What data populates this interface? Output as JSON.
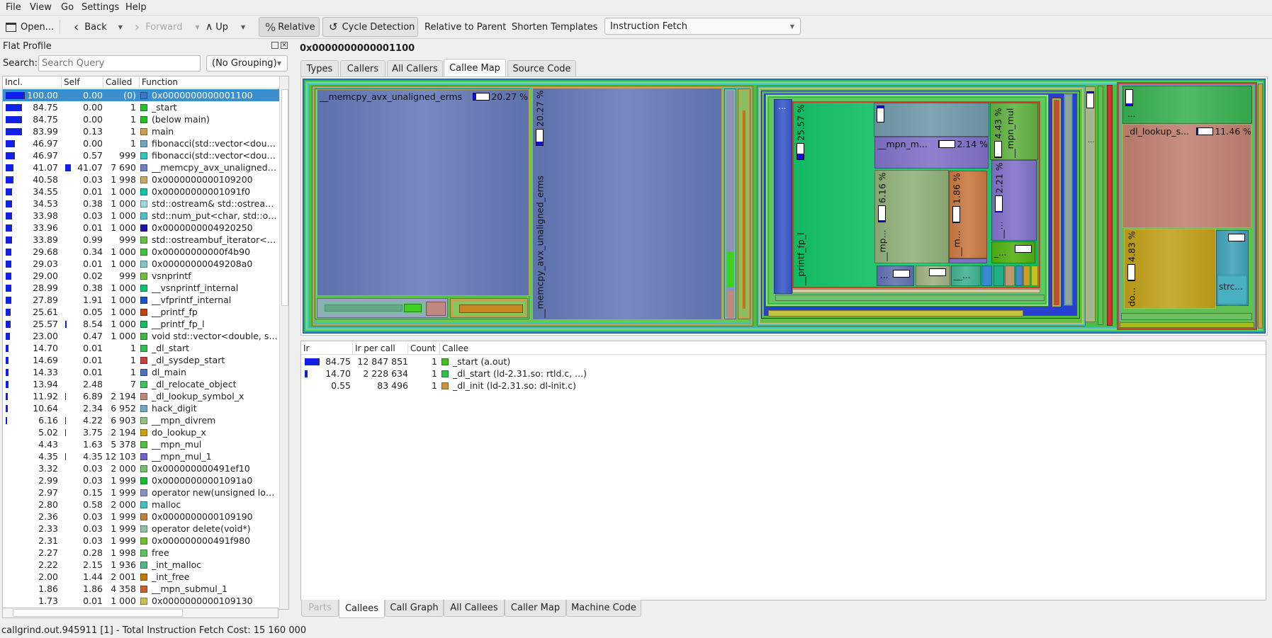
{
  "menu": [
    "File",
    "View",
    "Go",
    "Settings",
    "Help"
  ],
  "toolbar": {
    "open": "Open...",
    "back": "Back",
    "forward": "Forward",
    "up": "Up",
    "relative": "Relative",
    "cycle": "Cycle Detection",
    "relative_parent": "Relative to Parent",
    "shorten": "Shorten Templates",
    "event_type": "Instruction Fetch"
  },
  "flat_profile": {
    "title": "Flat Profile",
    "search_label": "Search:",
    "search_placeholder": "Search Query",
    "grouping": "(No Grouping)",
    "columns": [
      "Incl.",
      "Self",
      "Called",
      "Function"
    ],
    "rows": [
      {
        "incl": "100.00",
        "self": "0.00",
        "called": "(0)",
        "fn": "0x0000000000001100",
        "color": "#3c78c0",
        "selected": true
      },
      {
        "incl": "84.75",
        "self": "0.00",
        "called": "1",
        "fn": "_start",
        "color": "#2dbd2d"
      },
      {
        "incl": "84.75",
        "self": "0.00",
        "called": "1",
        "fn": "(below main)",
        "color": "#22c022"
      },
      {
        "incl": "83.99",
        "self": "0.13",
        "called": "1",
        "fn": "main",
        "color": "#c8a050"
      },
      {
        "incl": "46.97",
        "self": "0.00",
        "called": "1",
        "fn": "fibonacci(std::vector<double, std::allocator<double> >&)",
        "color": "#70a8c0"
      },
      {
        "incl": "46.97",
        "self": "0.57",
        "called": "999",
        "fn": "fibonacci(std::vector<double, std::allocator<double> >&)",
        "color": "#30c8b8"
      },
      {
        "incl": "41.07",
        "self": "41.07",
        "called": "7 690",
        "fn": "__memcpy_avx_unaligned_erms",
        "color": "#7080c0"
      },
      {
        "incl": "40.58",
        "self": "0.03",
        "called": "1 998",
        "fn": "0x0000000000109200",
        "color": "#c8a860"
      },
      {
        "incl": "34.55",
        "self": "0.01",
        "called": "1 000",
        "fn": "0x00000000001091f0",
        "color": "#10c0a8"
      },
      {
        "incl": "34.53",
        "self": "0.38",
        "called": "1 000",
        "fn": "std::ostream& std::ostream::_M_insert<double>(double)",
        "color": "#a0d8d8"
      },
      {
        "incl": "33.98",
        "self": "0.03",
        "called": "1 000",
        "fn": "std::num_put<char, std::ostreambuf_iterator<char> >",
        "color": "#50c0c8"
      },
      {
        "incl": "33.96",
        "self": "0.01",
        "called": "1 000",
        "fn": "0x0000000004920250",
        "color": "#2010b0"
      },
      {
        "incl": "33.89",
        "self": "0.99",
        "called": "999",
        "fn": "std::ostreambuf_iterator<char, std::char_traits<char> >",
        "color": "#60c040"
      },
      {
        "incl": "29.68",
        "self": "0.34",
        "called": "1 000",
        "fn": "0x00000000000f4b90",
        "color": "#40c040"
      },
      {
        "incl": "29.03",
        "self": "0.01",
        "called": "1 000",
        "fn": "0x00000000049208a0",
        "color": "#80c8c8"
      },
      {
        "incl": "29.00",
        "self": "0.02",
        "called": "999",
        "fn": "vsnprintf",
        "color": "#70c040"
      },
      {
        "incl": "28.99",
        "self": "0.38",
        "called": "1 000",
        "fn": "__vsnprintf_internal",
        "color": "#10c070"
      },
      {
        "incl": "27.89",
        "self": "1.91",
        "called": "1 000",
        "fn": "__vfprintf_internal",
        "color": "#2050c8"
      },
      {
        "incl": "25.61",
        "self": "0.05",
        "called": "1 000",
        "fn": "__printf_fp",
        "color": "#c04010"
      },
      {
        "incl": "25.57",
        "self": "8.54",
        "called": "1 000",
        "fn": "__printf_fp_l",
        "color": "#10c060"
      },
      {
        "incl": "23.00",
        "self": "0.47",
        "called": "1 000",
        "fn": "void std::vector<double, std::allocator<double> >",
        "color": "#40b840"
      },
      {
        "incl": "14.70",
        "self": "0.01",
        "called": "1",
        "fn": "_dl_start",
        "color": "#30c050"
      },
      {
        "incl": "14.69",
        "self": "0.01",
        "called": "1",
        "fn": "_dl_sysdep_start",
        "color": "#c84040"
      },
      {
        "incl": "14.33",
        "self": "0.01",
        "called": "1",
        "fn": "dl_main",
        "color": "#5070c0"
      },
      {
        "incl": "13.94",
        "self": "2.48",
        "called": "7",
        "fn": "_dl_relocate_object",
        "color": "#40c060"
      },
      {
        "incl": "11.92",
        "self": "6.89",
        "called": "2 194",
        "fn": "_dl_lookup_symbol_x",
        "color": "#c08878"
      },
      {
        "incl": "10.64",
        "self": "2.34",
        "called": "6 952",
        "fn": "hack_digit",
        "color": "#70a8c0"
      },
      {
        "incl": "6.16",
        "self": "4.22",
        "called": "6 903",
        "fn": "__mpn_divrem",
        "color": "#90c080"
      },
      {
        "incl": "5.02",
        "self": "3.75",
        "called": "2 194",
        "fn": "do_lookup_x",
        "color": "#c8a010"
      },
      {
        "incl": "4.43",
        "self": "1.63",
        "called": "5 378",
        "fn": "__mpn_mul",
        "color": "#50c040"
      },
      {
        "incl": "4.35",
        "self": "4.35",
        "called": "12 103",
        "fn": "__mpn_mul_1",
        "color": "#7060c8"
      },
      {
        "incl": "3.32",
        "self": "0.03",
        "called": "2 000",
        "fn": "0x000000000491ef10",
        "color": "#70c070"
      },
      {
        "incl": "2.99",
        "self": "0.03",
        "called": "1 999",
        "fn": "0x00000000001091a0",
        "color": "#10c030"
      },
      {
        "incl": "2.97",
        "self": "0.15",
        "called": "1 999",
        "fn": "operator new(unsigned long)",
        "color": "#9090c0"
      },
      {
        "incl": "2.80",
        "self": "0.58",
        "called": "2 000",
        "fn": "malloc",
        "color": "#40c0c0"
      },
      {
        "incl": "2.36",
        "self": "0.03",
        "called": "1 999",
        "fn": "0x0000000000109190",
        "color": "#c08040"
      },
      {
        "incl": "2.33",
        "self": "0.03",
        "called": "1 999",
        "fn": "operator delete(void*)",
        "color": "#90c0a0"
      },
      {
        "incl": "2.31",
        "self": "0.03",
        "called": "1 999",
        "fn": "0x000000000491f980",
        "color": "#70c030"
      },
      {
        "incl": "2.27",
        "self": "0.28",
        "called": "1 998",
        "fn": "free",
        "color": "#60c060"
      },
      {
        "incl": "2.22",
        "self": "2.15",
        "called": "1 936",
        "fn": "_int_malloc",
        "color": "#50b888"
      },
      {
        "incl": "2.00",
        "self": "1.44",
        "called": "2 001",
        "fn": "_int_free",
        "color": "#c07800"
      },
      {
        "incl": "1.86",
        "self": "1.86",
        "called": "4 358",
        "fn": "__mpn_submul_1",
        "color": "#c86030"
      },
      {
        "incl": "1.73",
        "self": "0.01",
        "called": "1 000",
        "fn": "0x0000000000109130",
        "color": "#c8c050"
      }
    ]
  },
  "detail": {
    "title": "0x0000000000001100",
    "top_tabs": [
      {
        "label": "Types"
      },
      {
        "label": "Callers"
      },
      {
        "label": "All Callers"
      },
      {
        "label": "Callee Map",
        "active": true
      },
      {
        "label": "Source Code"
      }
    ],
    "treemap": [
      {
        "label": "__memcpy_avx_unaligned_erms",
        "pct": "20.27 %",
        "color": "#6378b8"
      },
      {
        "label": "__memcpy_avx_unaligned_erms",
        "pct": "20.27 %",
        "color": "#6378b8"
      },
      {
        "label": "__printf_fp_l",
        "pct": "25.57 %",
        "color": "#14c468"
      },
      {
        "label": "...",
        "pct": "",
        "color": "#3858c8"
      },
      {
        "label": "__mpn_m...",
        "pct": "2.14 %",
        "color": "#8070c8"
      },
      {
        "label": "__mp...",
        "pct": "6.16 %",
        "color": "#90b078"
      },
      {
        "label": "__m...",
        "pct": "1.86 %",
        "color": "#c87840"
      },
      {
        "label": "__mpn_mul",
        "pct": "4.43 %",
        "color": "#60b040"
      },
      {
        "label": "__...",
        "pct": "2.21 %",
        "color": "#8070c8"
      },
      {
        "label": "_...",
        "pct": "",
        "color": "#50b010"
      },
      {
        "label": "...",
        "pct": "",
        "color": "#6070b0"
      },
      {
        "label": "__...",
        "pct": "",
        "color": "#40b090"
      },
      {
        "label": "_dl_lookup_s...",
        "pct": "11.46 %",
        "color": "#c08070"
      },
      {
        "label": "do...",
        "pct": "4.83 %",
        "color": "#c0a018"
      },
      {
        "label": "strc...",
        "pct": "",
        "color": "#40a8b8"
      },
      {
        "label": "...",
        "pct": "",
        "color": "#38b050"
      },
      {
        "label": "...",
        "pct": "",
        "color": "#90a890"
      }
    ],
    "callees": {
      "columns": [
        "Ir",
        "Ir per call",
        "Count",
        "Callee"
      ],
      "rows": [
        {
          "ir": "84.75",
          "per_call": "12 847 851",
          "count": "1",
          "callee": "_start (a.out)",
          "color": "#40c020"
        },
        {
          "ir": "14.70",
          "per_call": "2 228 634",
          "count": "1",
          "callee": "_dl_start (ld-2.31.so: rtld.c, ...)",
          "color": "#30c050"
        },
        {
          "ir": "0.55",
          "per_call": "83 496",
          "count": "1",
          "callee": "_dl_init (ld-2.31.so: dl-init.c)",
          "color": "#c89838"
        }
      ]
    },
    "bottom_tabs": [
      {
        "label": "Parts",
        "disabled": true
      },
      {
        "label": "Callees",
        "active": true
      },
      {
        "label": "Call Graph"
      },
      {
        "label": "All Callees"
      },
      {
        "label": "Caller Map"
      },
      {
        "label": "Machine Code"
      }
    ]
  },
  "status": "callgrind.out.945911 [1] - Total Instruction Fetch Cost: 15 160 000"
}
